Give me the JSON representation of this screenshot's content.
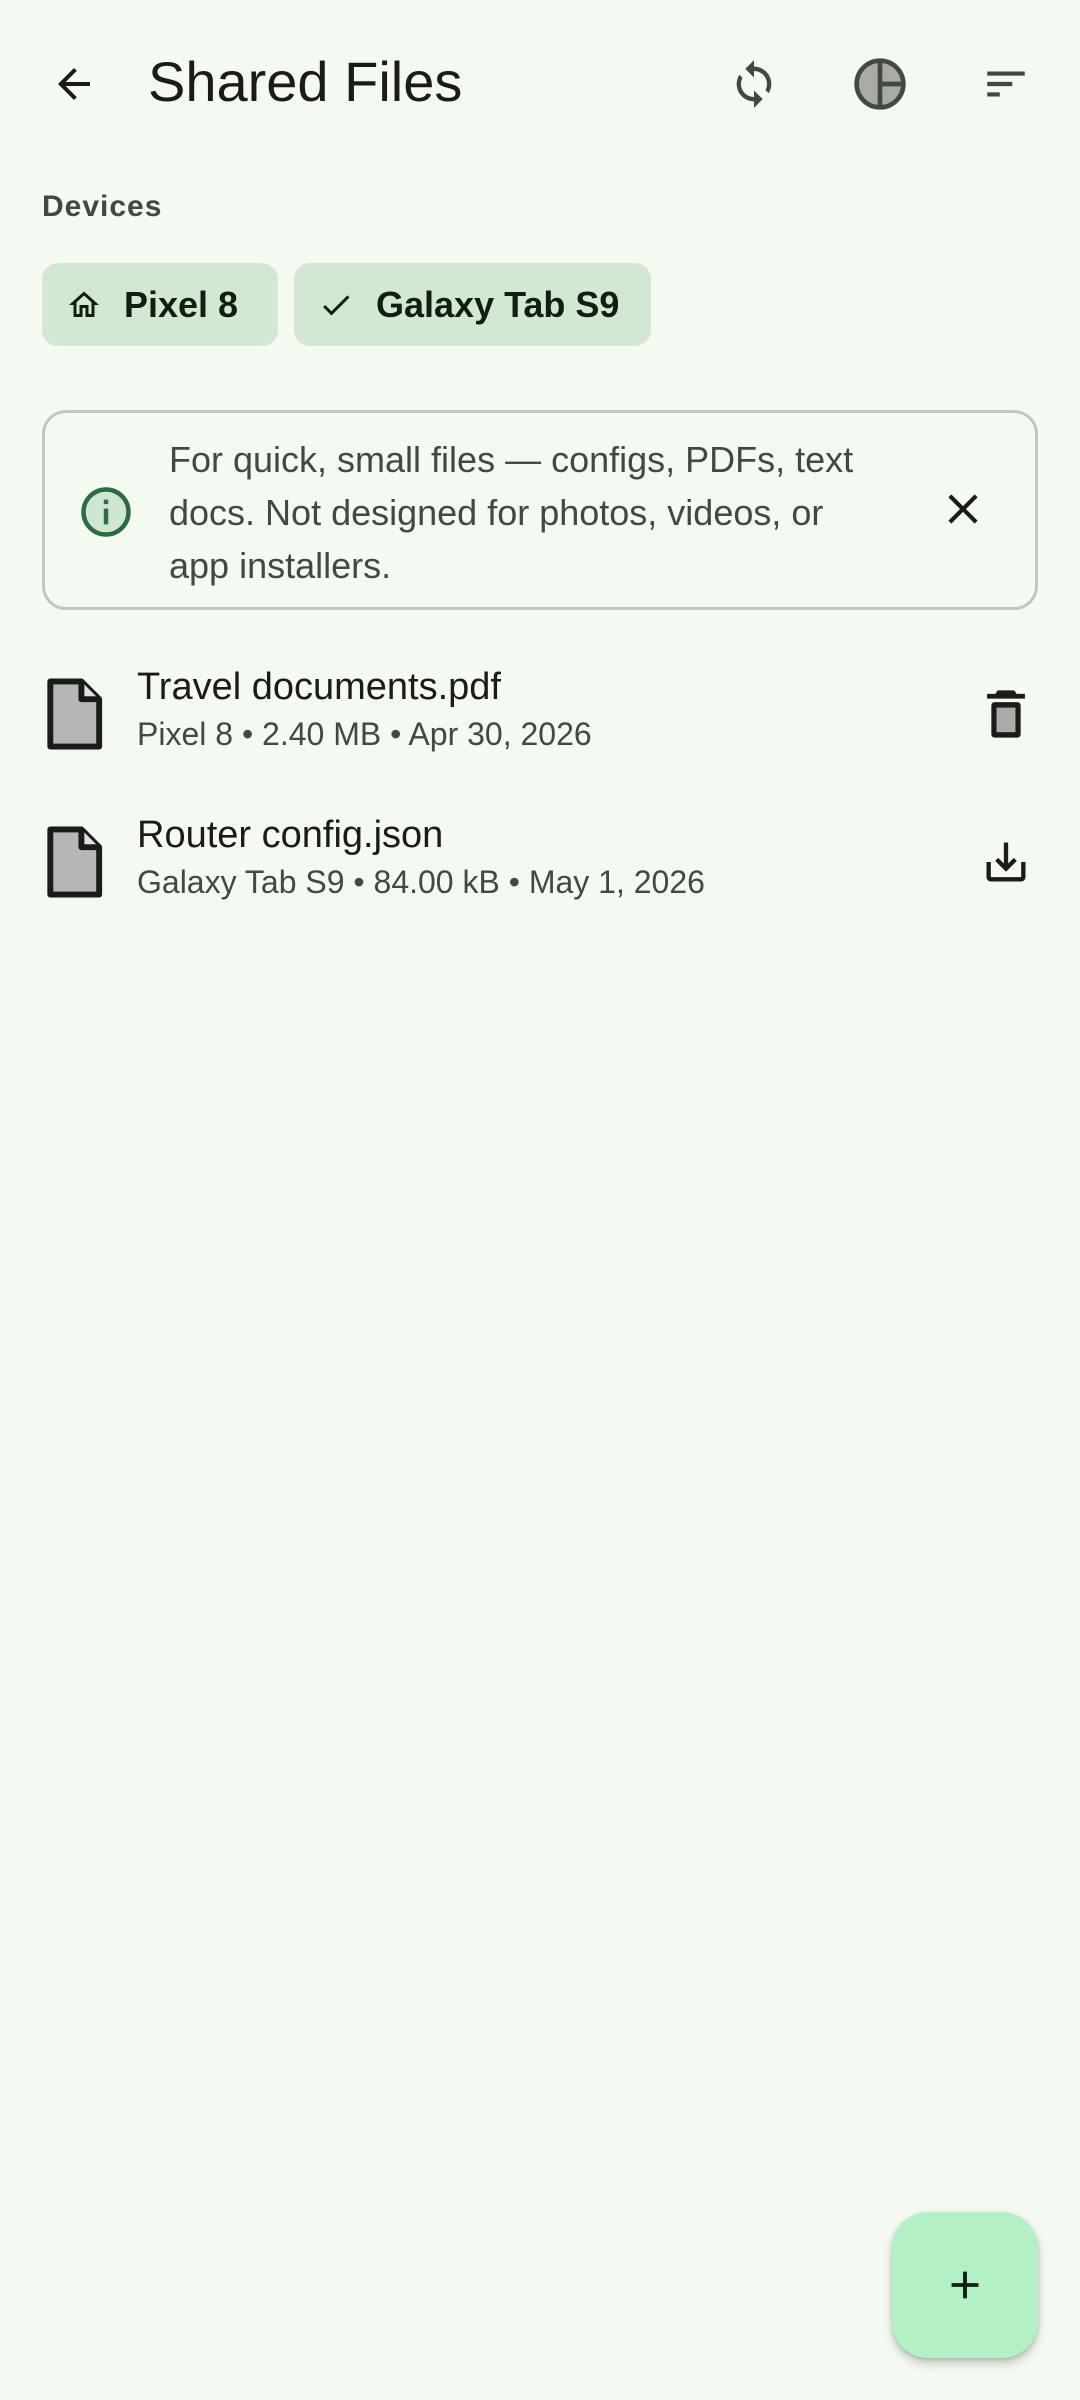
{
  "header": {
    "title": "Shared Files",
    "back_icon": "arrow-back-icon",
    "sync_icon": "sync-icon",
    "theme_icon": "contrast-icon",
    "sort_icon": "sort-icon"
  },
  "devices": {
    "label": "Devices",
    "chips": [
      {
        "label": "Pixel 8",
        "icon": "home-icon"
      },
      {
        "label": "Galaxy Tab S9",
        "icon": "check-icon"
      }
    ]
  },
  "banner": {
    "text": "For quick, small files — configs, PDFs, text docs. Not designed for photos, videos, or app installers.",
    "icon": "info-icon",
    "close_icon": "close-icon"
  },
  "files": [
    {
      "name": "Travel documents.pdf",
      "meta": "Pixel 8 • 2.40 MB • Apr 30, 2026",
      "action_icon": "delete-icon"
    },
    {
      "name": "Router config.json",
      "meta": "Galaxy Tab S9 • 84.00 kB • May 1, 2026",
      "action_icon": "download-icon"
    }
  ],
  "fab": {
    "icon": "add-icon"
  },
  "colors": {
    "background": "#f4f9f1",
    "chip": "#d3e8d4",
    "fab": "#b4f0c6",
    "accent": "#2f6b42"
  }
}
